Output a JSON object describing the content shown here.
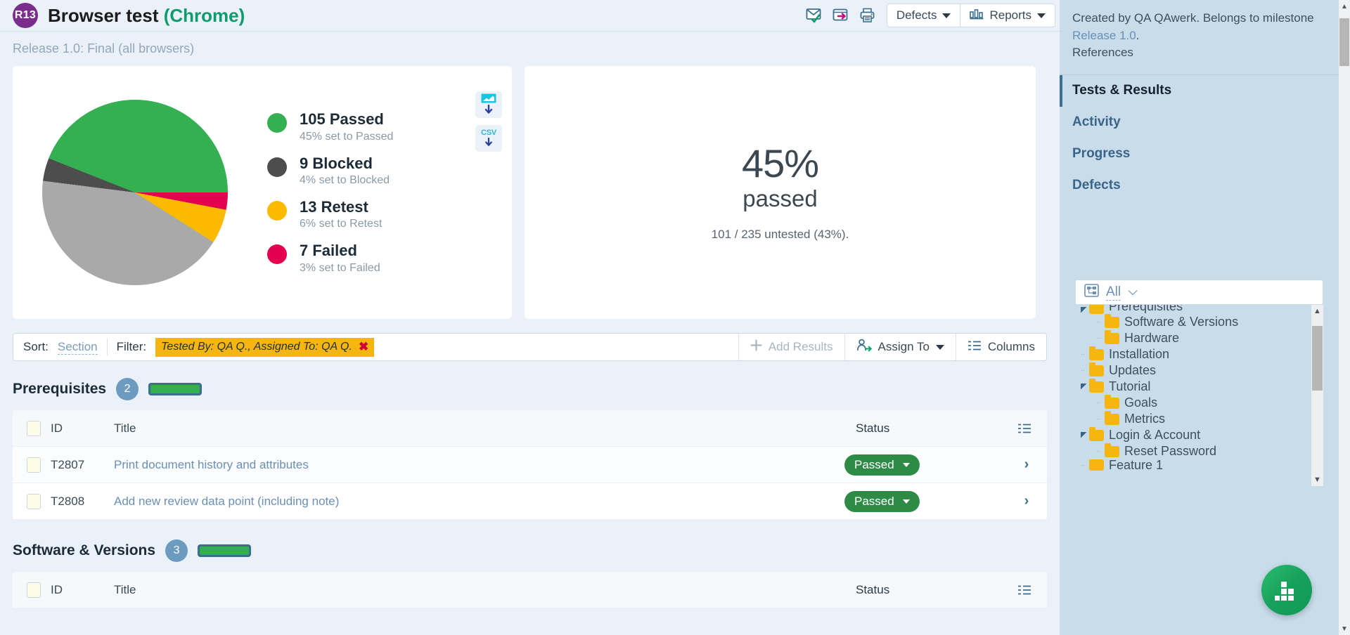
{
  "header": {
    "run_id": "R13",
    "title": "Browser test",
    "title_paren": "(Chrome)",
    "icons": [
      "subscribe-mail-icon",
      "push-to-icon",
      "print-icon"
    ],
    "defects_label": "Defects",
    "reports_label": "Reports"
  },
  "breadcrumb": "Release 1.0: Final (all browsers)",
  "chart_data": {
    "type": "pie",
    "title": "",
    "legend_position": "right",
    "categories": [
      "Passed",
      "Blocked",
      "Retest",
      "Failed",
      "Untested"
    ],
    "values": [
      105,
      9,
      13,
      7,
      101
    ],
    "percents": [
      45,
      4,
      6,
      3,
      43
    ],
    "colors": [
      "#34b052",
      "#4d4d4d",
      "#fbba00",
      "#e3004f",
      "#a9a9a9"
    ],
    "legend": [
      {
        "count": "105 Passed",
        "sub": "45% set to Passed",
        "color": "#34b052"
      },
      {
        "count": "9 Blocked",
        "sub": "4% set to Blocked",
        "color": "#4d4d4d"
      },
      {
        "count": "13 Retest",
        "sub": "6% set to Retest",
        "color": "#fbba00"
      },
      {
        "count": "7 Failed",
        "sub": "3% set to Failed",
        "color": "#e3004f"
      }
    ],
    "total": 235
  },
  "exports": {
    "image_label": "image-download-icon",
    "csv_label": "CSV"
  },
  "summary": {
    "big": "45%",
    "word": "passed",
    "sub": "101 / 235 untested (43%)."
  },
  "filterbar": {
    "sort_label": "Sort:",
    "sort_value": "Section",
    "filter_label": "Filter:",
    "filter_chip": "Tested By: QA Q., Assigned To: QA Q.",
    "chip_clear": "✖",
    "add_results": "Add Results",
    "assign_to": "Assign To",
    "columns": "Columns"
  },
  "sections": [
    {
      "title": "Prerequisites",
      "count": "2",
      "progress": 100,
      "columns": {
        "id": "ID",
        "title": "Title",
        "status": "Status"
      },
      "rows": [
        {
          "id": "T2807",
          "title": "Print document history and attributes",
          "status": "Passed"
        },
        {
          "id": "T2808",
          "title": "Add new review data point (including note)",
          "status": "Passed"
        }
      ]
    },
    {
      "title": "Software & Versions",
      "count": "3",
      "progress": 100,
      "columns": {
        "id": "ID",
        "title": "Title",
        "status": "Status"
      },
      "rows": []
    }
  ],
  "sidebar": {
    "meta_prefix": "Created by QA QAwerk. Belongs to milestone ",
    "meta_link": "Release 1.0",
    "meta_suffix": ".",
    "meta_line2": "References",
    "nav": [
      {
        "label": "Tests & Results",
        "active": true
      },
      {
        "label": "Activity",
        "active": false
      },
      {
        "label": "Progress",
        "active": false
      },
      {
        "label": "Defects",
        "active": false
      }
    ],
    "tree": {
      "filter_label": "All",
      "nodes": [
        {
          "label": "Prerequisites",
          "depth": 0,
          "expanded": true,
          "clipped": true
        },
        {
          "label": "Software & Versions",
          "depth": 1,
          "expanded": false,
          "clipped": false
        },
        {
          "label": "Hardware",
          "depth": 1,
          "expanded": false,
          "clipped": false
        },
        {
          "label": "Installation",
          "depth": 0,
          "expanded": false,
          "clipped": false
        },
        {
          "label": "Updates",
          "depth": 0,
          "expanded": false,
          "clipped": false
        },
        {
          "label": "Tutorial",
          "depth": 0,
          "expanded": true,
          "clipped": false
        },
        {
          "label": "Goals",
          "depth": 1,
          "expanded": false,
          "clipped": false
        },
        {
          "label": "Metrics",
          "depth": 1,
          "expanded": false,
          "clipped": false
        },
        {
          "label": "Login & Account",
          "depth": 0,
          "expanded": true,
          "clipped": false
        },
        {
          "label": "Reset Password",
          "depth": 1,
          "expanded": false,
          "clipped": false
        },
        {
          "label": "Feature 1",
          "depth": 0,
          "expanded": false,
          "clipped": true
        }
      ]
    }
  },
  "fab": {
    "name": "quick-actions-fab"
  }
}
